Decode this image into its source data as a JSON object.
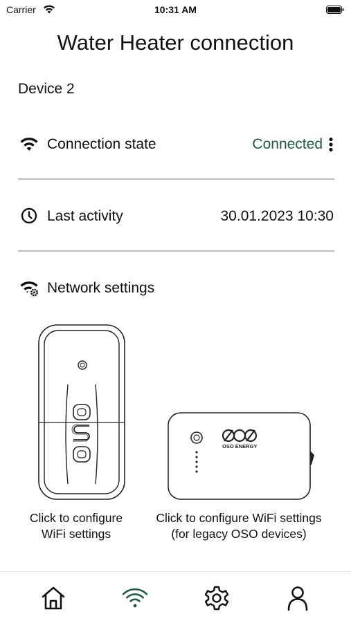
{
  "status_bar": {
    "carrier": "Carrier",
    "time": "10:31 AM"
  },
  "page": {
    "title": "Water Heater connection",
    "device_name": "Device 2"
  },
  "connection": {
    "label": "Connection state",
    "value": "Connected",
    "value_color": "#1c5a46"
  },
  "activity": {
    "label": "Last activity",
    "value": "30.01.2023 10:30"
  },
  "network": {
    "label": "Network settings"
  },
  "devices": {
    "oso_caption_line1": "Click to configure",
    "oso_caption_line2": "WiFi settings",
    "legacy_caption_line1": "Click to configure WiFi settings",
    "legacy_caption_line2": "(for legacy OSO devices)",
    "legacy_logo_text": "OSO ENERGY"
  },
  "tab_bar": {
    "active_color": "#1c5a46",
    "tabs": [
      "home-icon",
      "wifi-icon",
      "gear-icon",
      "person-icon"
    ],
    "active_tab": "wifi-icon"
  }
}
